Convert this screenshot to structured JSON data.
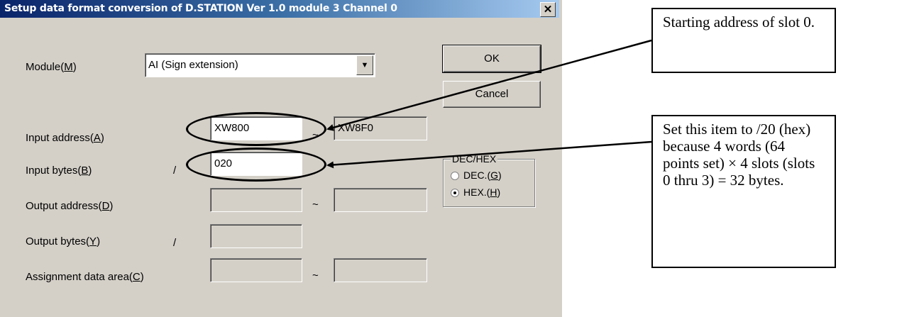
{
  "dialog": {
    "title": "Setup data format conversion of D.STATION Ver 1.0 module 3 Channel 0",
    "close_label": "✕"
  },
  "module": {
    "label_pre": "Module(",
    "label_key": "M",
    "label_post": ")",
    "selected": "AI (Sign extension)"
  },
  "buttons": {
    "ok": "OK",
    "cancel": "Cancel"
  },
  "fields": {
    "input_address": {
      "label_pre": "Input address(",
      "key": "A",
      "label_post": ")",
      "from": "XW800",
      "tilde": "~",
      "to": "XW8F0"
    },
    "input_bytes": {
      "label_pre": "Input bytes(",
      "key": "B",
      "label_post": ")",
      "slash": "/",
      "value": "020"
    },
    "output_address": {
      "label_pre": "Output address(",
      "key": "D",
      "label_post": ")",
      "from": "",
      "tilde": "~",
      "to": ""
    },
    "output_bytes": {
      "label_pre": "Output bytes(",
      "key": "Y",
      "label_post": ")",
      "slash": "/",
      "value": ""
    },
    "assignment_area": {
      "label_pre": "Assignment data area(",
      "key": "C",
      "label_post": ")",
      "from": "",
      "tilde": "~",
      "to": ""
    }
  },
  "dechex": {
    "title": "DEC/HEX",
    "dec_pre": "DEC.(",
    "dec_key": "G",
    "dec_post": ")",
    "hex_pre": "HEX.(",
    "hex_key": "H",
    "hex_post": ")",
    "selected": "HEX"
  },
  "callouts": {
    "slot": "Starting address of slot 0.",
    "bytes": "Set this item to /20 (hex) because 4 words (64 points set) × 4 slots (slots 0 thru 3) = 32 bytes."
  }
}
